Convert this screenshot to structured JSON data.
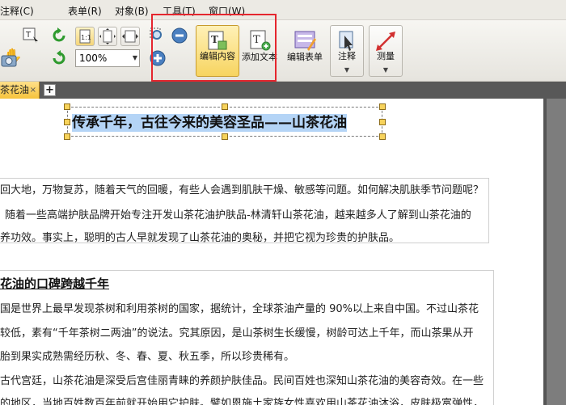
{
  "menu": {
    "items": [
      "注释(C)",
      "表单(R)",
      "对象(B)",
      "工具(T)",
      "窗口(W)"
    ]
  },
  "toolbar": {
    "zoom": "100%",
    "buttons": {
      "edit_content": "编辑内容",
      "add_text": "添加文本",
      "edit_form": "编辑表单",
      "annotate": "注释",
      "measure": "测量"
    },
    "highlight_color": "#e5262e",
    "active_color": "#f7d460"
  },
  "tabs": {
    "doc_tab": "茶花油",
    "close_glyph": "×",
    "add_glyph": "+"
  },
  "document": {
    "title": "传承千年，古往今来的美容圣品——山茶花油",
    "intro_lines": [
      "回大地，万物复苏，随着天气的回暖，有些人会遇到肌肤干燥、敏感等问题。如何解决肌肤季节问题呢？",
      "随着一些高端护肤品牌开始专注开发山茶花油护肤品-林清轩山茶花油，越来越多人了解到山茶花油的",
      "养功效。事实上，聪明的古人早就发现了山茶花油的奥秘，并把它视为珍贵的护肤品。"
    ],
    "section_heading": "花油的口碑跨越千年",
    "section_lines": [
      "国是世界上最早发现茶树和利用茶树的国家，据统计，全球茶油产量的 90%以上来自中国。不过山茶花",
      "较低，素有“千年茶树二两油”的说法。究其原因，是山茶树生长缓慢，树龄可达上千年，而山茶果从开",
      "胎到果实成熟需经历秋、冬、春、夏、秋五季，所以珍贵稀有。",
      "古代宫廷，山茶花油是深受后宫佳丽青睐的养颜护肤佳品。民间百姓也深知山茶花油的美容奇效。在一些",
      "的地区，当地百姓数百年前就开始用它护肤。譬如恩施土家族女性喜欢用山茶花油沐浴，皮肤极富弹性，"
    ]
  }
}
